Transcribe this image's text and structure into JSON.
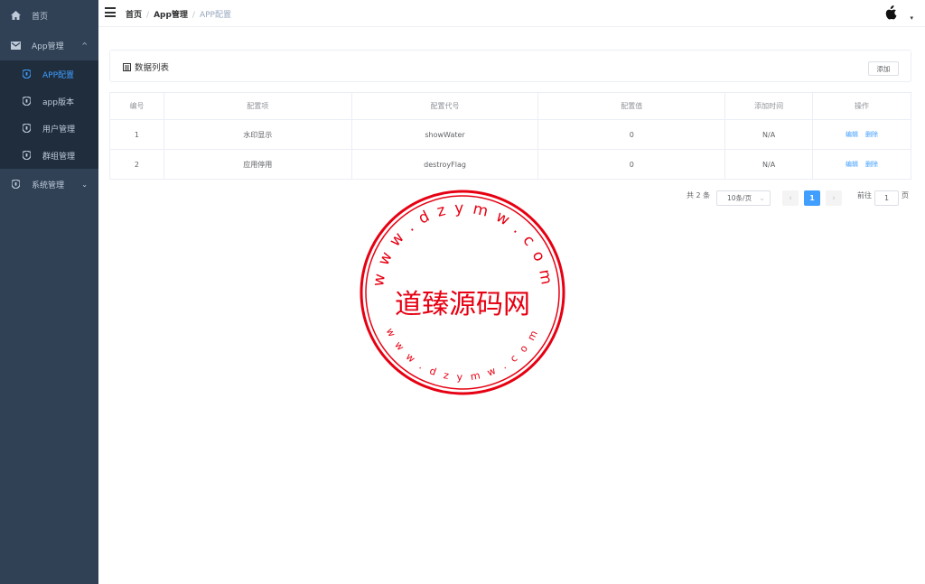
{
  "sidebar": {
    "items": [
      {
        "label": "首页",
        "icon": "home-icon"
      },
      {
        "label": "App管理",
        "icon": "mail-icon"
      },
      {
        "label": "APP配置",
        "icon": "shield-icon"
      },
      {
        "label": "app版本",
        "icon": "shield-icon"
      },
      {
        "label": "用户管理",
        "icon": "shield-icon"
      },
      {
        "label": "群组管理",
        "icon": "shield-icon"
      },
      {
        "label": "系统管理",
        "icon": "shield-icon"
      }
    ]
  },
  "breadcrumb": {
    "home": "首页",
    "section": "App管理",
    "current": "APP配置",
    "sep": "/"
  },
  "card": {
    "title": "数据列表",
    "add_label": "添加"
  },
  "table": {
    "headers": [
      "编号",
      "配置项",
      "配置代号",
      "配置值",
      "添加时间",
      "操作"
    ],
    "rows": [
      {
        "id": "1",
        "name": "水印显示",
        "code": "showWater",
        "value": "0",
        "time": "N/A"
      },
      {
        "id": "2",
        "name": "应用停用",
        "code": "destroyFlag",
        "value": "0",
        "time": "N/A"
      }
    ],
    "edit_label": "编辑",
    "delete_label": "删除"
  },
  "pagination": {
    "total": "共 2 条",
    "page_size": "10条/页",
    "current_page": "1",
    "goto_label": "前往",
    "goto_value": "1",
    "page_unit": "页"
  },
  "watermark": {
    "center_text": "道臻源码网",
    "top_arc": "w w w . d z y m w . c o m",
    "bottom_arc": "w w w . d z y m w . c o m"
  },
  "colors": {
    "sidebar_bg": "#304156",
    "accent": "#409eff",
    "seal": "#e60012"
  }
}
